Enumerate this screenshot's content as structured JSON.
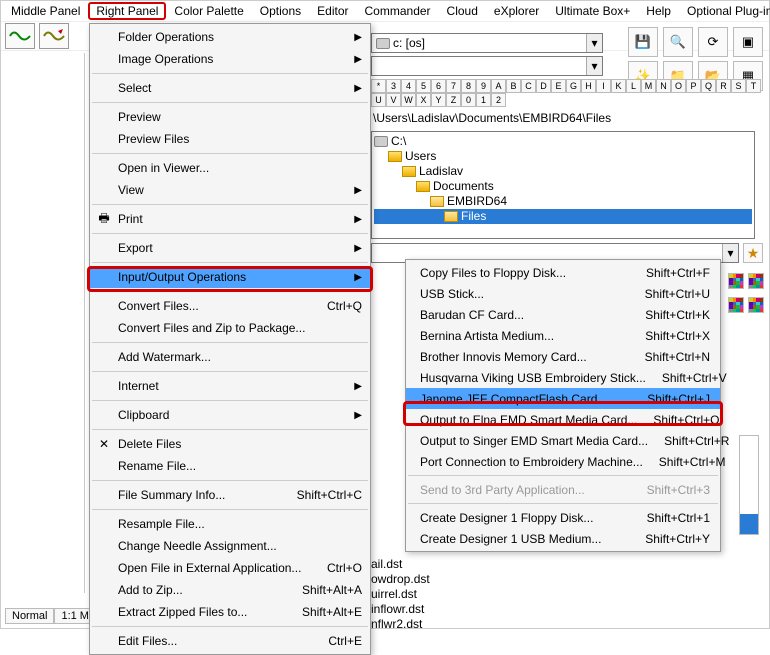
{
  "menubar": {
    "items": [
      "Middle Panel",
      "Right Panel",
      "Color Palette",
      "Options",
      "Editor",
      "Commander",
      "Cloud",
      "eXplorer",
      "Ultimate Box+",
      "Help",
      "Optional Plug-ins"
    ],
    "highlighted_index": 1
  },
  "drive_combo": {
    "icon": "drive",
    "label": "c: [os]"
  },
  "alpha_row1": [
    "*",
    "3",
    "4",
    "5",
    "6",
    "7",
    "8",
    "9",
    "A",
    "B",
    "C",
    "D",
    "E",
    "G",
    "H",
    "I",
    "K",
    "L",
    "M",
    "N",
    "O",
    "P",
    "Q",
    "R",
    "S",
    "T"
  ],
  "alpha_row2": [
    "U",
    "V",
    "W",
    "X",
    "Y",
    "Z",
    "0",
    "1",
    "2"
  ],
  "path_bar": "\\Users\\Ladislav\\Documents\\EMBIRD64\\Files",
  "tree": [
    {
      "indent": 0,
      "icon": "drive",
      "label": "C:\\",
      "sel": false
    },
    {
      "indent": 1,
      "icon": "folder",
      "label": "Users",
      "sel": false
    },
    {
      "indent": 2,
      "icon": "folder",
      "label": "Ladislav",
      "sel": false
    },
    {
      "indent": 3,
      "icon": "folder",
      "label": "Documents",
      "sel": false
    },
    {
      "indent": 4,
      "icon": "open",
      "label": "EMBIRD64",
      "sel": false
    },
    {
      "indent": 5,
      "icon": "open",
      "label": "Files",
      "sel": true
    }
  ],
  "ctx": {
    "items": [
      {
        "label": "Folder Operations",
        "submenu": true
      },
      {
        "label": "Image Operations",
        "submenu": true
      },
      {
        "sep": true
      },
      {
        "label": "Select",
        "submenu": true
      },
      {
        "sep": true
      },
      {
        "label": "Preview"
      },
      {
        "label": "Preview Files"
      },
      {
        "sep": true
      },
      {
        "label": "Open in Viewer..."
      },
      {
        "label": "View",
        "submenu": true
      },
      {
        "sep": true
      },
      {
        "label": "Print",
        "submenu": true,
        "icon": "🖶"
      },
      {
        "sep": true
      },
      {
        "label": "Export",
        "submenu": true
      },
      {
        "sep": true
      },
      {
        "label": "Input/Output Operations",
        "submenu": true,
        "hl": true
      },
      {
        "sep": true
      },
      {
        "label": "Convert Files...",
        "shortcut": "Ctrl+Q"
      },
      {
        "label": "Convert Files and Zip to Package..."
      },
      {
        "sep": true
      },
      {
        "label": "Add Watermark..."
      },
      {
        "sep": true
      },
      {
        "label": "Internet",
        "submenu": true
      },
      {
        "sep": true
      },
      {
        "label": "Clipboard",
        "submenu": true
      },
      {
        "sep": true
      },
      {
        "label": "Delete Files",
        "icon": "✕"
      },
      {
        "label": "Rename File..."
      },
      {
        "sep": true
      },
      {
        "label": "File Summary Info...",
        "shortcut": "Shift+Ctrl+C"
      },
      {
        "sep": true
      },
      {
        "label": "Resample File..."
      },
      {
        "label": "Change Needle Assignment..."
      },
      {
        "label": "Open File in External Application...",
        "shortcut": "Ctrl+O"
      },
      {
        "label": "Add to Zip...",
        "shortcut": "Shift+Alt+A"
      },
      {
        "label": "Extract Zipped Files to...",
        "shortcut": "Shift+Alt+E"
      },
      {
        "sep": true
      },
      {
        "label": "Edit Files...",
        "shortcut": "Ctrl+E"
      }
    ]
  },
  "sub": {
    "items": [
      {
        "label": "Copy Files to Floppy Disk...",
        "shortcut": "Shift+Ctrl+F"
      },
      {
        "label": "USB Stick...",
        "shortcut": "Shift+Ctrl+U"
      },
      {
        "label": "Barudan CF Card...",
        "shortcut": "Shift+Ctrl+K"
      },
      {
        "label": "Bernina Artista Medium...",
        "shortcut": "Shift+Ctrl+X"
      },
      {
        "label": "Brother Innovis Memory Card...",
        "shortcut": "Shift+Ctrl+N"
      },
      {
        "label": "Husqvarna Viking USB Embroidery Stick...",
        "shortcut": "Shift+Ctrl+V"
      },
      {
        "label": "Janome JEF CompactFlash Card...",
        "shortcut": "Shift+Ctrl+J",
        "hl": true
      },
      {
        "label": "Output to Elna EMD Smart Media Card...",
        "shortcut": "Shift+Ctrl+O"
      },
      {
        "label": "Output to Singer EMD Smart Media Card...",
        "shortcut": "Shift+Ctrl+R"
      },
      {
        "label": "Port Connection to Embroidery Machine...",
        "shortcut": "Shift+Ctrl+M"
      },
      {
        "sep": true
      },
      {
        "label": "Send to 3rd Party Application...",
        "shortcut": "Shift+Ctrl+3",
        "disabled": true
      },
      {
        "sep": true
      },
      {
        "label": "Create Designer 1 Floppy Disk...",
        "shortcut": "Shift+Ctrl+1"
      },
      {
        "label": "Create Designer 1 USB Medium...",
        "shortcut": "Shift+Ctrl+Y"
      }
    ]
  },
  "file_list_fragment": [
    "ail.dst",
    "owdrop.dst",
    "uirrel.dst",
    "inflowr.dst",
    "nflwr2.dst"
  ],
  "right_tool_icons": {
    "row1": [
      "save",
      "zoom-in",
      "refresh",
      "cascade"
    ],
    "row2": [
      "wand",
      "folder",
      "folder-open",
      "grid"
    ]
  },
  "status_tabs": [
    "Normal",
    "1:1 M"
  ]
}
